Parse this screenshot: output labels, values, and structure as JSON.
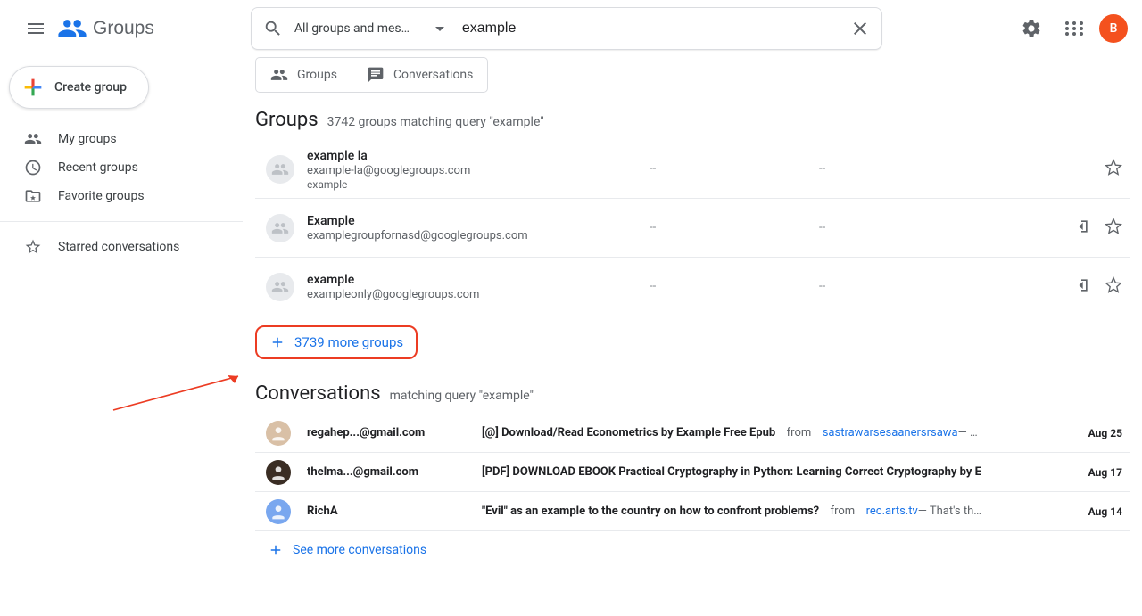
{
  "header": {
    "product_name": "Groups",
    "search_scope": "All groups and mes…",
    "search_value": "example",
    "avatar_letter": "B",
    "avatar_bg": "#f4511e"
  },
  "sidebar": {
    "create_label": "Create group",
    "items": [
      {
        "icon": "group-icon",
        "label": "My groups"
      },
      {
        "icon": "clock-icon",
        "label": "Recent groups"
      },
      {
        "icon": "favorite-folder-icon",
        "label": "Favorite groups"
      }
    ],
    "starred_label": "Starred conversations"
  },
  "tabs": {
    "groups": "Groups",
    "conversations": "Conversations"
  },
  "groups_section": {
    "title": "Groups",
    "subtitle": "3742 groups matching query \"example\"",
    "rows": [
      {
        "name": "example la",
        "email": "example-la@googlegroups.com",
        "desc": "example",
        "col1": "--",
        "col2": "--",
        "show_leave": false
      },
      {
        "name": "Example",
        "email": "examplegroupfornasd@googlegroups.com",
        "desc": "",
        "col1": "--",
        "col2": "--",
        "show_leave": true
      },
      {
        "name": "example",
        "email": "exampleonly@googlegroups.com",
        "desc": "",
        "col1": "--",
        "col2": "--",
        "show_leave": true
      }
    ],
    "more_label": "3739 more groups"
  },
  "conversations_section": {
    "title": "Conversations",
    "subtitle": "matching query \"example\"",
    "rows": [
      {
        "sender": "regahep...@gmail.com",
        "subject": "[@] Download/Read Econometrics by Example Free Epub",
        "from_word": "from",
        "link": "sastrawarsesaanersrsawa",
        "snippet": " — …",
        "date": "Aug 25",
        "avatar_color": "#d9c0a6"
      },
      {
        "sender": "thelma...@gmail.com",
        "subject": "[PDF] DOWNLOAD EBOOK Practical Cryptography in Python: Learning Correct Cryptography by E",
        "from_word": "",
        "link": "",
        "snippet": "",
        "date": "Aug 17",
        "avatar_color": "#3a2d24"
      },
      {
        "sender": "RichA",
        "subject": "\"Evil\" as an example to the country on how to confront problems?",
        "from_word": "from",
        "link": "rec.arts.tv",
        "snippet": " — That's th…",
        "date": "Aug 14",
        "avatar_color": "#79a7ef"
      }
    ],
    "more_label": "See more conversations"
  }
}
